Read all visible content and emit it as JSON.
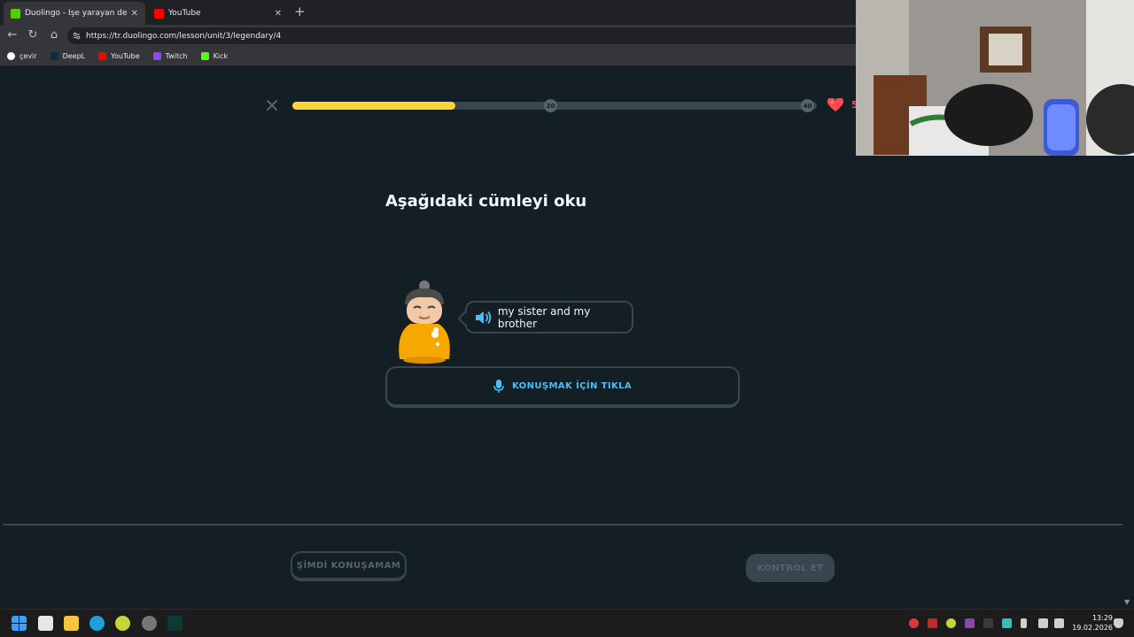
{
  "browser": {
    "tabs": [
      {
        "title": "Duolingo - İşe yarayan derslerle İn",
        "active": true,
        "favicon_color": "#58cc02"
      },
      {
        "title": "YouTube",
        "active": false,
        "favicon_color": "#ff0000"
      }
    ],
    "new_tab_label": "+",
    "url": "https://tr.duolingo.com/lesson/unit/3/legendary/4",
    "bookmarks": [
      {
        "label": "çevir",
        "icon": "google-icon"
      },
      {
        "label": "DeepL",
        "icon": "deepl-icon"
      },
      {
        "label": "YouTube",
        "icon": "youtube-icon"
      },
      {
        "label": "Twitch",
        "icon": "twitch-icon"
      },
      {
        "label": "Kick",
        "icon": "kick-icon"
      }
    ]
  },
  "lesson": {
    "progress_fraction": 0.31,
    "milestones": [
      "20",
      "40"
    ],
    "hearts": "5",
    "prompt_title": "Aşağıdaki cümleyi oku",
    "sentence": "my sister and my brother",
    "speak_button_label": "KONUŞMAK İÇİN TIKLA",
    "cant_speak_label": "ŞİMDİ KONUŞAMAM",
    "check_label": "KONTROL ET"
  },
  "colors": {
    "background": "#131f24",
    "progress": "#fcd535",
    "accent_blue": "#49c0f8",
    "border": "#37464f",
    "heart": "#ff4b4b"
  },
  "taskbar": {
    "time": "13:29",
    "date": "19.02.2026"
  }
}
